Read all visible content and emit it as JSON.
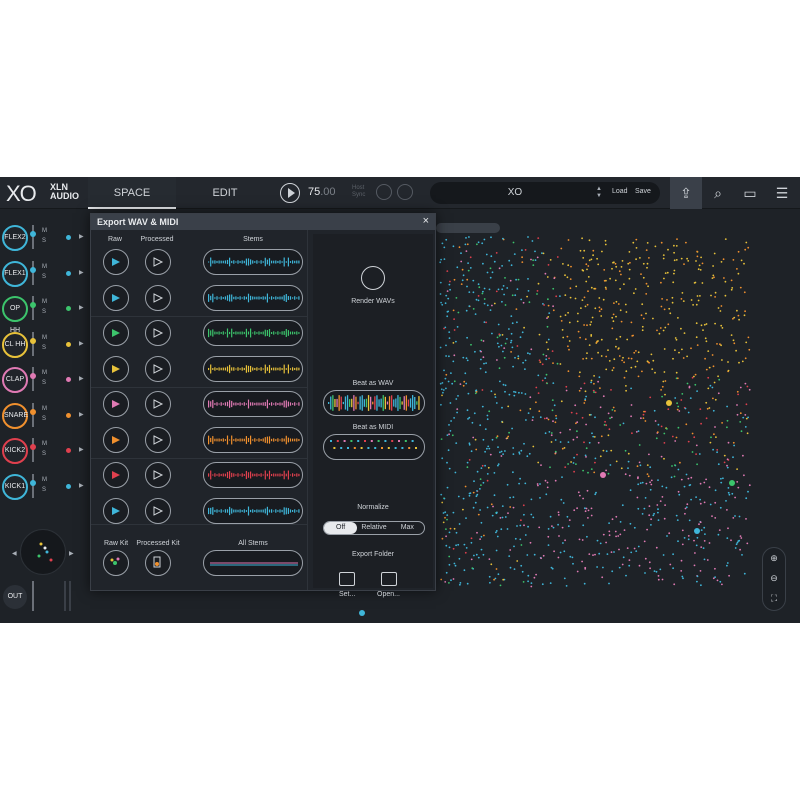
{
  "header": {
    "logo": "XO",
    "brand_line1": "XLN",
    "brand_line2": "AUDIO",
    "tabs": [
      {
        "label": "SPACE"
      },
      {
        "label": "EDIT"
      }
    ],
    "tempo": "75",
    "tempo_decimal": ".00",
    "host_sync_line1": "Host",
    "host_sync_line2": "Sync",
    "preset_name": "XO",
    "load_label": "Load",
    "save_label": "Save"
  },
  "channels": [
    {
      "label": "FLEX2",
      "color": "#3fb6d9",
      "m": "M",
      "s": "S"
    },
    {
      "label": "FLEX1",
      "color": "#3fb6d9",
      "m": "M",
      "s": "S"
    },
    {
      "label": "OP HH",
      "color": "#3cc46c",
      "m": "M",
      "s": "S"
    },
    {
      "label": "CL HH",
      "color": "#e8c23a",
      "m": "M",
      "s": "S"
    },
    {
      "label": "CLAP",
      "color": "#e07ab4",
      "m": "M",
      "s": "S"
    },
    {
      "label": "SNARE",
      "color": "#f0902e",
      "m": "M",
      "s": "S"
    },
    {
      "label": "KICK2",
      "color": "#e0404e",
      "m": "M",
      "s": "S"
    },
    {
      "label": "KICK1",
      "color": "#3fb6d9",
      "m": "M",
      "s": "S"
    }
  ],
  "out_label": "OUT",
  "modal": {
    "title": "Export WAV & MIDI",
    "close": "×",
    "col_raw": "Raw",
    "col_processed": "Processed",
    "col_stems": "Stems",
    "rows": [
      {
        "color": "#3fb6d9"
      },
      {
        "color": "#3fb6d9"
      },
      {
        "color": "#3cc46c"
      },
      {
        "color": "#e8c23a"
      },
      {
        "color": "#e07ab4"
      },
      {
        "color": "#f0902e"
      },
      {
        "color": "#e0404e"
      },
      {
        "color": "#3fb6d9"
      }
    ],
    "raw_kit": "Raw Kit",
    "processed_kit": "Processed Kit",
    "all_stems": "All Stems",
    "render_wavs": "Render WAVs",
    "beat_as_wav": "Beat as WAV",
    "beat_as_midi": "Beat as MIDI",
    "normalize": "Normalize",
    "normalize_options": [
      "Off",
      "Relative",
      "Max"
    ],
    "normalize_selected": "Off",
    "export_folder": "Export Folder",
    "set_label": "Set...",
    "open_label": "Open..."
  },
  "colors": {
    "background": "#1e2227",
    "accent": "#e8eaed",
    "kick": "#e0404e",
    "snare": "#f0902e",
    "hat": "#3cc46c",
    "clap": "#e07ab4",
    "flex": "#3fb6d9",
    "closed_hat": "#e8c23a"
  }
}
